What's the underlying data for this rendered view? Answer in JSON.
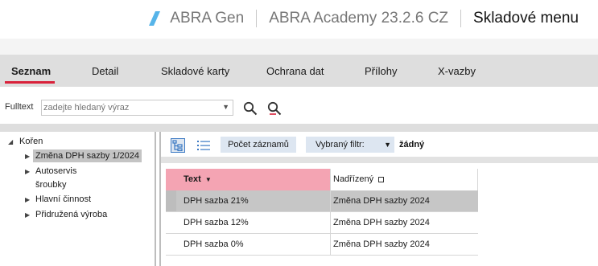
{
  "header": {
    "app_name": "ABRA Gen",
    "company": "ABRA Academy 23.2.6 CZ",
    "page_title": "Skladové menu",
    "accent_color": "#56b4e9"
  },
  "tabs": [
    {
      "label": "Seznam",
      "active": true
    },
    {
      "label": "Detail",
      "active": false
    },
    {
      "label": "Skladové karty",
      "active": false
    },
    {
      "label": "Ochrana dat",
      "active": false
    },
    {
      "label": "Přílohy",
      "active": false
    },
    {
      "label": "X-vazby",
      "active": false
    }
  ],
  "search": {
    "label": "Fulltext",
    "placeholder": "zadejte hledaný výraz"
  },
  "tree": {
    "root": "Kořen",
    "items": [
      {
        "label": "Změna DPH sazby 1/2024",
        "selected": true,
        "expandable": true
      },
      {
        "label": "Autoservis",
        "selected": false,
        "expandable": true
      },
      {
        "label": "šroubky",
        "selected": false,
        "expandable": false
      },
      {
        "label": "Hlavní činnost",
        "selected": false,
        "expandable": true
      },
      {
        "label": "Přidružená výroba",
        "selected": false,
        "expandable": true
      }
    ]
  },
  "toolbar": {
    "count_button": "Počet záznamů",
    "filter_label": "Vybraný filtr:",
    "filter_value": "žádný"
  },
  "grid": {
    "columns": [
      "Text",
      "Nadřízený"
    ],
    "rows": [
      {
        "text": "DPH sazba 21%",
        "parent": "Změna DPH sazby 2024",
        "selected": true
      },
      {
        "text": "DPH sazba 12%",
        "parent": "Změna DPH sazby 2024",
        "selected": false
      },
      {
        "text": "DPH sazba 0%",
        "parent": "Změna DPH sazby 2024",
        "selected": false
      }
    ]
  }
}
